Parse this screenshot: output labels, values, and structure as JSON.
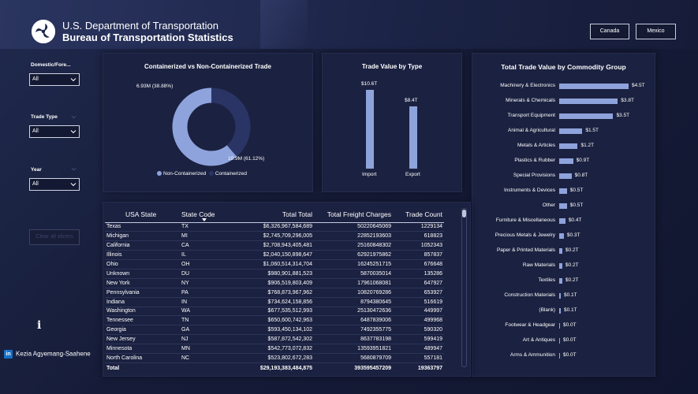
{
  "header": {
    "org_line1": "U.S. Department of Transportation",
    "org_line2": "Bureau of Transportation Statistics",
    "nav": [
      "Canada",
      "Mexico"
    ]
  },
  "slicers": [
    {
      "label": "Domestic/Fore...",
      "value": "All"
    },
    {
      "label": "Trade Type",
      "value": "All"
    },
    {
      "label": "Year",
      "value": "All"
    }
  ],
  "clear_label": "Clear all slicers",
  "info_icon": "i",
  "author": {
    "icon": "in",
    "name": "Kezia Agyemang-Saahene"
  },
  "colors": {
    "accent": "#8ea3dc",
    "non_containerized": "#8ea3dc",
    "containerized": "#2a3566",
    "panel": "#1b2140"
  },
  "chart_data": [
    {
      "type": "pie",
      "title": "Containerized vs Non-Containerized Trade",
      "slices": [
        {
          "name": "Non-Containerized",
          "value": 10.9,
          "label": "10.9M (61.12%)",
          "percent": 61.12
        },
        {
          "name": "Containerized",
          "value": 6.93,
          "label": "6.93M (38.88%)",
          "percent": 38.88
        }
      ],
      "legend": [
        "Non-Containerized",
        "Containerized"
      ]
    },
    {
      "type": "bar",
      "title": "Trade Value by Type",
      "categories": [
        "Import",
        "Export"
      ],
      "values": [
        10.6,
        8.4
      ],
      "labels": [
        "$10.6T",
        "$8.4T"
      ]
    },
    {
      "type": "bar",
      "orientation": "horizontal",
      "title": "Total Trade Value by Commodity Group",
      "categories": [
        "Machinery & Electronics",
        "Minerals & Chemicals",
        "Transport Equipment",
        "Animal & Agricultural",
        "Metals & Articles",
        "Plastics & Rubber",
        "Special Provisions",
        "Instruments & Devices",
        "Other",
        "Furniture & Miscellaneous",
        "Precious Metals & Jewelry",
        "Paper & Printed Materials",
        "Raw Materials",
        "Textiles",
        "Construction Materials",
        "(Blank)",
        "Footwear & Headgear",
        "Art & Antiques",
        "Arms & Ammunition"
      ],
      "values": [
        4.5,
        3.8,
        3.5,
        1.5,
        1.2,
        0.9,
        0.8,
        0.5,
        0.5,
        0.4,
        0.3,
        0.2,
        0.2,
        0.2,
        0.1,
        0.1,
        0.0,
        0.0,
        0.0
      ],
      "labels": [
        "$4.5T",
        "$3.8T",
        "$3.5T",
        "$1.5T",
        "$1.2T",
        "$0.9T",
        "$0.8T",
        "$0.5T",
        "$0.5T",
        "$0.4T",
        "$0.3T",
        "$0.2T",
        "$0.2T",
        "$0.2T",
        "$0.1T",
        "$0.1T",
        "$0.0T",
        "$0.0T",
        "$0.0T"
      ]
    },
    {
      "type": "table",
      "columns": [
        "USA State",
        "State Code",
        "Total Total",
        "Total Freight Charges",
        "Trade Count"
      ],
      "rows": [
        [
          "Texas",
          "TX",
          "$6,326,967,584,689",
          "50220645069",
          "1229134"
        ],
        [
          "Michigan",
          "MI",
          "$2,745,709,296,005",
          "22852193603",
          "618823"
        ],
        [
          "California",
          "CA",
          "$2,708,943,405,481",
          "25160848302",
          "1052343"
        ],
        [
          "Illinois",
          "IL",
          "$2,040,150,898,647",
          "62921975862",
          "857837"
        ],
        [
          "Ohio",
          "OH",
          "$1,060,514,314,704",
          "16245251715",
          "676648"
        ],
        [
          "Unknown",
          "DU",
          "$980,901,881,523",
          "5870035014",
          "135286"
        ],
        [
          "New York",
          "NY",
          "$906,519,803,409",
          "17961068081",
          "647927"
        ],
        [
          "Pennsylvania",
          "PA",
          "$768,873,967,962",
          "10820769286",
          "653927"
        ],
        [
          "Indiana",
          "IN",
          "$734,624,158,856",
          "8794380645",
          "516619"
        ],
        [
          "Washington",
          "WA",
          "$677,535,512,993",
          "25130472636",
          "449997"
        ],
        [
          "Tennessee",
          "TN",
          "$650,600,742,963",
          "6487839006",
          "499968"
        ],
        [
          "Georgia",
          "GA",
          "$593,450,134,102",
          "7492355775",
          "590320"
        ],
        [
          "New Jersey",
          "NJ",
          "$587,872,542,302",
          "8637783198",
          "599419"
        ],
        [
          "Minnesota",
          "MN",
          "$542,773,072,832",
          "13593951821",
          "489947"
        ],
        [
          "North Carolina",
          "NC",
          "$523,802,672,283",
          "5680879709",
          "557181"
        ]
      ],
      "total": [
        "Total",
        "",
        "$29,193,383,484,875",
        "393595457209",
        "19363797"
      ]
    }
  ]
}
